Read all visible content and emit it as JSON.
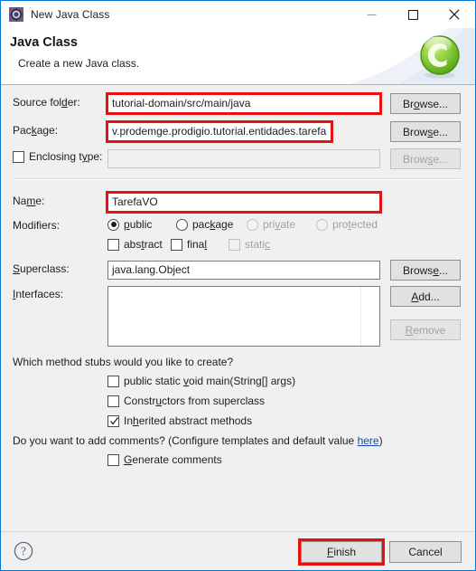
{
  "window": {
    "title": "New Java Class",
    "icon": "eclipse-wizard-icon",
    "minimize_label": "–",
    "maximize_label": "□",
    "close_label": "✕",
    "border_color": "#0078d7"
  },
  "header": {
    "title": "Java Class",
    "subtitle": "Create a new Java class.",
    "logo": "green-c-badge-icon"
  },
  "form": {
    "source_folder": {
      "label_pre": "Source fol",
      "label_mnemonic": "d",
      "label_post": "er:",
      "value": "tutorial-domain/src/main/java",
      "browse": {
        "pre": "Br",
        "mnemonic": "o",
        "post": "wse..."
      }
    },
    "package": {
      "label_pre": "Pac",
      "label_mnemonic": "k",
      "label_post": "age:",
      "value": "v.prodemge.prodigio.tutorial.entidades.tarefa",
      "browse": {
        "pre": "Brow",
        "mnemonic": "s",
        "post": "e..."
      }
    },
    "enclosing_type": {
      "label_pre": "Enclosing t",
      "label_mnemonic": "y",
      "label_post": "pe:",
      "value": "",
      "checked": false,
      "browse": {
        "pre": "Brow",
        "mnemonic": "s",
        "post": "e..."
      }
    },
    "name": {
      "label_pre": "Na",
      "label_mnemonic": "m",
      "label_post": "e:",
      "value": "TarefaVO"
    },
    "modifiers": {
      "label": "Modifiers:",
      "radios": [
        {
          "pre": "",
          "mnemonic": "p",
          "post": "ublic",
          "selected": true,
          "enabled": true
        },
        {
          "pre": "pac",
          "mnemonic": "k",
          "post": "age",
          "selected": false,
          "enabled": true
        },
        {
          "pre": "pri",
          "mnemonic": "v",
          "post": "ate",
          "selected": false,
          "enabled": false
        },
        {
          "pre": "pro",
          "mnemonic": "t",
          "post": "ected",
          "selected": false,
          "enabled": false
        }
      ],
      "checks": [
        {
          "pre": "abs",
          "mnemonic": "t",
          "post": "ract",
          "checked": false,
          "enabled": true
        },
        {
          "pre": "fina",
          "mnemonic": "l",
          "post": "",
          "checked": false,
          "enabled": true
        },
        {
          "pre": "stati",
          "mnemonic": "c",
          "post": "",
          "checked": false,
          "enabled": false
        }
      ]
    },
    "superclass": {
      "label_pre": "",
      "label_mnemonic": "S",
      "label_post": "uperclass:",
      "value": "java.lang.Object",
      "browse": {
        "pre": "Brows",
        "mnemonic": "e",
        "post": "..."
      }
    },
    "interfaces": {
      "label_pre": "",
      "label_mnemonic": "I",
      "label_post": "nterfaces:",
      "items": [],
      "add": {
        "pre": "",
        "mnemonic": "A",
        "post": "dd..."
      },
      "remove": {
        "pre": "",
        "mnemonic": "R",
        "post": "emove"
      }
    },
    "stubs": {
      "question": "Which method stubs would you like to create?",
      "options": [
        {
          "pre": "public static ",
          "mnemonic": "v",
          "post": "oid main(String[] args)",
          "checked": false
        },
        {
          "pre": "Constr",
          "mnemonic": "u",
          "post": "ctors from superclass",
          "checked": false
        },
        {
          "pre": "In",
          "mnemonic": "h",
          "post": "erited abstract methods",
          "checked": true
        }
      ]
    },
    "comments": {
      "question_pre": "Do you want to add comments? (Configure templates and default value ",
      "link": "here",
      "question_post": ")",
      "option": {
        "pre": "",
        "mnemonic": "G",
        "post": "enerate comments",
        "checked": false
      }
    }
  },
  "footer": {
    "help": "help-icon",
    "finish": {
      "pre": "",
      "mnemonic": "F",
      "post": "inish"
    },
    "cancel": {
      "pre": "",
      "mnemonic": "",
      "post": "Cancel"
    }
  },
  "annotations": {
    "highlight_color": "#e81111",
    "boxes": [
      "source-folder-field",
      "package-field",
      "name-field",
      "finish-button"
    ]
  }
}
